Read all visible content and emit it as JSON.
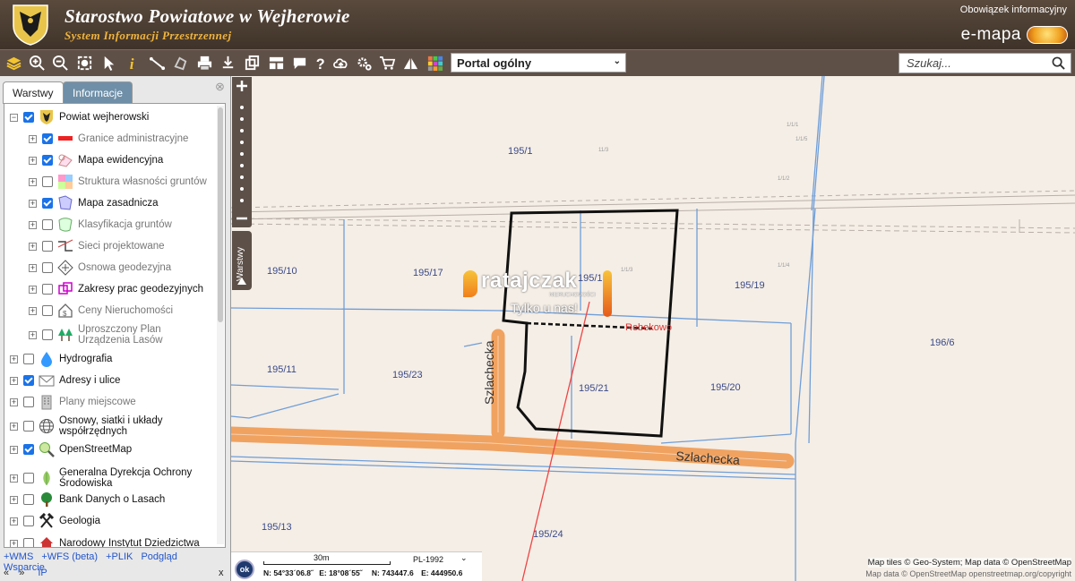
{
  "header": {
    "title": "Starostwo Powiatowe w Wejherowie",
    "subtitle": "System Informacji Przestrzennej",
    "info_link": "Obowiązek informacyjny",
    "brand": "e-mapa"
  },
  "toolbar": {
    "portal_value": "Portal ogólny",
    "search_placeholder": "Szukaj..."
  },
  "panel": {
    "tabs": [
      {
        "label": "Warstwy",
        "active": true
      },
      {
        "label": "Informacje",
        "active": false
      }
    ],
    "layers": [
      {
        "label": "Powiat wejherowski",
        "checked": true,
        "level": 0,
        "expand": "minus",
        "icon": "crest-icon",
        "dim": false
      },
      {
        "label": "Granice administracyjne",
        "checked": true,
        "level": 1,
        "expand": "plus",
        "icon": "boundary-icon",
        "dim": true
      },
      {
        "label": "Mapa ewidencyjna",
        "checked": true,
        "level": 1,
        "expand": "plus",
        "icon": "cadastral-map-icon",
        "dim": false
      },
      {
        "label": "Struktura własności gruntów",
        "checked": false,
        "level": 1,
        "expand": "plus",
        "icon": "ownership-icon",
        "dim": true
      },
      {
        "label": "Mapa zasadnicza",
        "checked": true,
        "level": 1,
        "expand": "plus",
        "icon": "base-map-icon",
        "dim": false
      },
      {
        "label": "Klasyfikacja gruntów",
        "checked": false,
        "level": 1,
        "expand": "plus",
        "icon": "soil-class-icon",
        "dim": true
      },
      {
        "label": "Sieci projektowane",
        "checked": false,
        "level": 1,
        "expand": "plus",
        "icon": "network-icon",
        "dim": true
      },
      {
        "label": "Osnowa geodezyjna",
        "checked": false,
        "level": 1,
        "expand": "plus",
        "icon": "geodetic-point-icon",
        "dim": true
      },
      {
        "label": "Zakresy prac geodezyjnych",
        "checked": false,
        "level": 1,
        "expand": "plus",
        "icon": "survey-range-icon",
        "dim": false
      },
      {
        "label": "Ceny Nieruchomości",
        "checked": false,
        "level": 1,
        "expand": "plus",
        "icon": "price-house-icon",
        "dim": true
      },
      {
        "label": "Uproszczony Plan Urządzenia Lasów",
        "checked": false,
        "level": 1,
        "expand": "plus",
        "icon": "forest-icon",
        "dim": true
      },
      {
        "label": "Hydrografia",
        "checked": false,
        "level": 0,
        "expand": "plus",
        "icon": "water-drop-icon",
        "dim": false
      },
      {
        "label": "Adresy i ulice",
        "checked": true,
        "level": 0,
        "expand": "plus",
        "icon": "envelope-icon",
        "dim": false
      },
      {
        "label": "Plany miejscowe",
        "checked": false,
        "level": 0,
        "expand": "plus",
        "icon": "building-plan-icon",
        "dim": true
      },
      {
        "label": "Osnowy, siatki i układy współrzędnych",
        "checked": false,
        "level": 0,
        "expand": "plus",
        "icon": "globe-grid-icon",
        "dim": false
      },
      {
        "label": "OpenStreetMap",
        "checked": true,
        "level": 0,
        "expand": "plus",
        "icon": "magnifier-map-icon",
        "dim": false
      },
      {
        "label": "Generalna Dyrekcja Ochrony Środowiska",
        "checked": false,
        "level": 0,
        "expand": "plus",
        "icon": "leaf-icon",
        "dim": false
      },
      {
        "label": "Bank Danych o Lasach",
        "checked": false,
        "level": 0,
        "expand": "plus",
        "icon": "tree-icon",
        "dim": false
      },
      {
        "label": "Geologia",
        "checked": false,
        "level": 0,
        "expand": "plus",
        "icon": "hammers-icon",
        "dim": false
      },
      {
        "label": "Narodowy Instytut Dziedzictwa",
        "checked": false,
        "level": 0,
        "expand": "plus",
        "icon": "heritage-icon",
        "dim": false
      }
    ],
    "links": [
      "+WMS",
      "+WFS (beta)",
      "+PLIK",
      "Podgląd",
      "Wsparcie"
    ],
    "nav_prev": "«",
    "nav_next": "»",
    "ip_label": "IP",
    "close_label": "x"
  },
  "side": {
    "layers_tab": "Warstwy"
  },
  "map": {
    "parcels": [
      "195/1",
      "195/10",
      "195/17",
      "195/18",
      "195/19",
      "196/6",
      "195/11",
      "195/23",
      "195/21",
      "195/20",
      "195/13",
      "195/24"
    ],
    "streets": [
      "Szlachecka",
      "Szlachecka"
    ],
    "place": "Rebekowo",
    "watermark_brand": "ratajczak",
    "watermark_sub": "NIERUCHOMOŚCI",
    "watermark_slogan": "Tylko u nas!"
  },
  "status": {
    "ok_label": "ok",
    "scale_label": "30m",
    "crs": "PL-1992",
    "lat": "N: 54°33´06.8˝",
    "lon": "E: 18°08´55˝",
    "north": "N: 743447.6",
    "east": "E: 444950.6"
  },
  "attribution": {
    "line1": "Map tiles © Geo-System; Map data © OpenStreetMap",
    "line2": "Map data © OpenStreetMap openstreetmap.org/copyright"
  }
}
